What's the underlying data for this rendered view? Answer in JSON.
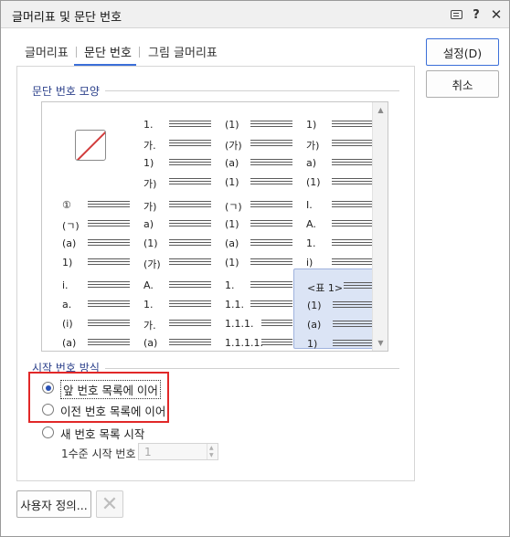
{
  "window": {
    "title": "글머리표 및 문단 번호"
  },
  "titlebar": {
    "help_glyph": "?",
    "close_glyph": "✕"
  },
  "tabs": [
    {
      "label": "글머리표",
      "active": false
    },
    {
      "label": "문단 번호",
      "active": true
    },
    {
      "label": "그림 글머리표",
      "active": false
    }
  ],
  "numbering": {
    "section_label": "문단 번호 모양",
    "styles": [
      [],
      [
        "1.",
        "가.",
        "1)",
        "가)"
      ],
      [
        "(1)",
        "(가)",
        "(a)",
        "(1)"
      ],
      [
        "1)",
        "가)",
        "a)",
        "(1)"
      ],
      [
        "①",
        "(ㄱ)",
        "(a)",
        "1)"
      ],
      [
        "가)",
        "a)",
        "(1)",
        "(가)"
      ],
      [
        "(ㄱ)",
        "(1)",
        "(a)",
        "(1)"
      ],
      [
        "I.",
        "A.",
        "1.",
        "i)"
      ],
      [
        "i.",
        "a.",
        "(i)",
        "(a)"
      ],
      [
        "A.",
        "1.",
        "가.",
        "(a)"
      ],
      [
        "1.",
        "1.1.",
        "1.1.1.",
        "1.1.1.1."
      ],
      [
        "<표 1>",
        "(1)",
        "(a)",
        "1)"
      ]
    ],
    "selected_index": 11,
    "accent_color": "#dbe4f5"
  },
  "start": {
    "section_label": "시작 번호 방식",
    "options": [
      {
        "label": "앞 번호 목록에 이어",
        "checked": true
      },
      {
        "label": "이전 번호 목록에 이어",
        "checked": false
      },
      {
        "label": "새 번호 목록 시작",
        "checked": false
      }
    ],
    "level_label": "1수준 시작 번호",
    "level_value": "1",
    "highlight_color": "#e12828"
  },
  "buttons": {
    "ok": "설정(D)",
    "cancel": "취소",
    "custom": "사용자 정의...",
    "delete_glyph": "✕"
  }
}
